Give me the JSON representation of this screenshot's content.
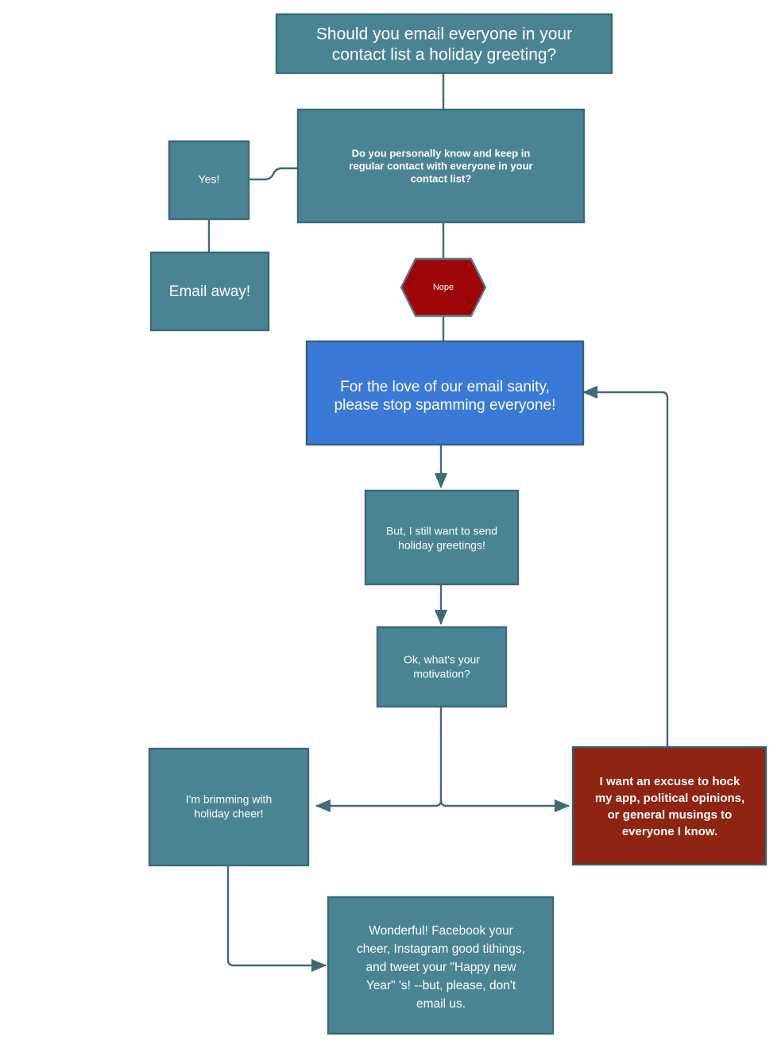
{
  "document": {
    "type": "flowchart",
    "title_text": "Should you email everyone in your contact list a holiday greeting?",
    "background_color": "#ffffff"
  },
  "colors": {
    "teal_fill": "#4a8494",
    "teal_border": "#3a6a78",
    "blue_fill": "#3b79d8",
    "blue_border": "#34607a",
    "red_fill": "#8e2411",
    "red_border": "#34607a",
    "hex_fill": "#9e0508",
    "hex_border": "#5a7f8c",
    "connector": "#3f6b78",
    "text_color": "#ffffff"
  },
  "nodes": {
    "title": {
      "label": "Should you email everyone in your contact list a holiday greeting?",
      "lines": [
        "Should you email everyone in your",
        "contact list a holiday greeting?"
      ],
      "shape": "rectangle",
      "fill": "#4a8494"
    },
    "decision": {
      "label": "Do you personally know and keep in regular contact with everyone in your contact list?",
      "lines": [
        "Do you personally know and keep in",
        "regular contact with everyone in your",
        "contact list?"
      ],
      "shape": "rectangle",
      "fill": "#4a8494"
    },
    "yes": {
      "label": "Yes!",
      "lines": [
        "Yes!"
      ],
      "shape": "rectangle",
      "fill": "#4a8494"
    },
    "email_away": {
      "label": "Email away!",
      "lines": [
        "Email away!"
      ],
      "shape": "rectangle",
      "fill": "#4a8494"
    },
    "nope": {
      "label": "Nope",
      "lines": [
        "Nope"
      ],
      "shape": "hexagon",
      "fill": "#9e0508"
    },
    "stop_spamming": {
      "label": "For the love of our email sanity, please stop spamming everyone!",
      "lines": [
        "For the love of our email sanity,",
        "please stop spamming everyone!"
      ],
      "shape": "rectangle",
      "fill": "#3b79d8"
    },
    "still_want": {
      "label": "But, I still want to send holiday greetings!",
      "lines": [
        "But, I still want to send",
        "holiday greetings!"
      ],
      "shape": "rectangle",
      "fill": "#4a8494"
    },
    "motivation": {
      "label": "Ok, what's your motivation?",
      "lines": [
        "Ok, what's your",
        "motivation?"
      ],
      "shape": "rectangle",
      "fill": "#4a8494"
    },
    "brimming": {
      "label": "I'm brimming with holiday cheer!",
      "lines": [
        "I'm brimming with",
        "holiday cheer!"
      ],
      "shape": "rectangle",
      "fill": "#4a8494"
    },
    "hock": {
      "label": "I want an excuse to hock my app, political opinions, or general musings to everyone I know.",
      "lines": [
        "I want an excuse to hock",
        "my app, political opinions,",
        "or general musings to",
        "everyone I know."
      ],
      "shape": "rectangle",
      "fill": "#8e2411"
    },
    "wonderful": {
      "label": "Wonderful! Facebook your cheer, Instagram good tithings, and tweet your \"Happy new Year\" 's! --but, please, don't email us.",
      "lines": [
        "Wonderful! Facebook your",
        "cheer, Instagram good tithings,",
        "and tweet your \"Happy new",
        "Year\" 's! --but, please, don't",
        "email us."
      ],
      "shape": "rectangle",
      "fill": "#4a8494"
    }
  },
  "edges": [
    {
      "from": "title",
      "to": "decision",
      "style": "plain"
    },
    {
      "from": "decision",
      "to": "yes",
      "style": "plain"
    },
    {
      "from": "yes",
      "to": "email_away",
      "style": "plain"
    },
    {
      "from": "decision",
      "to": "nope",
      "style": "plain"
    },
    {
      "from": "nope",
      "to": "stop_spamming",
      "style": "plain"
    },
    {
      "from": "stop_spamming",
      "to": "still_want",
      "style": "arrow"
    },
    {
      "from": "still_want",
      "to": "motivation",
      "style": "arrow"
    },
    {
      "from": "motivation",
      "to": "brimming",
      "style": "arrow"
    },
    {
      "from": "motivation",
      "to": "hock",
      "style": "arrow"
    },
    {
      "from": "hock",
      "to": "stop_spamming",
      "style": "arrow"
    },
    {
      "from": "brimming",
      "to": "wonderful",
      "style": "arrow"
    }
  ]
}
